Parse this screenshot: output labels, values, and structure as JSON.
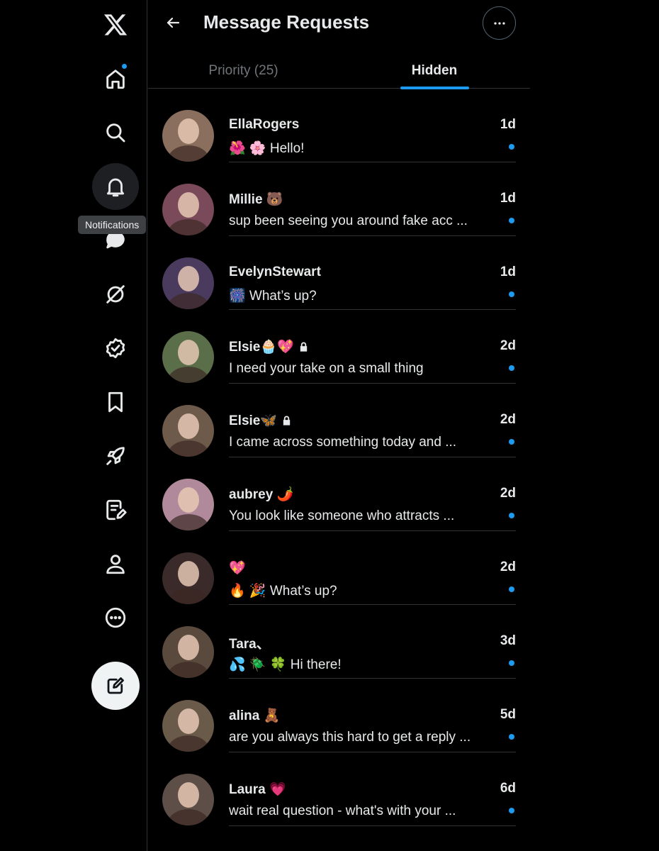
{
  "header": {
    "title": "Message Requests"
  },
  "tabs": [
    {
      "label": "Priority (25)",
      "active": false
    },
    {
      "label": "Hidden",
      "active": true
    }
  ],
  "sidebar": {
    "tooltip": "Notifications",
    "items": [
      {
        "icon": "x-logo-icon"
      },
      {
        "icon": "home-icon",
        "has_dot": true
      },
      {
        "icon": "search-icon"
      },
      {
        "icon": "bell-icon"
      },
      {
        "icon": "chat-bubble-icon"
      },
      {
        "icon": "grok-icon"
      },
      {
        "icon": "verified-badge-icon"
      },
      {
        "icon": "bookmark-icon"
      },
      {
        "icon": "rocket-icon"
      },
      {
        "icon": "notes-icon"
      },
      {
        "icon": "profile-icon"
      },
      {
        "icon": "more-circle-icon"
      },
      {
        "icon": "compose-icon"
      }
    ]
  },
  "messages": [
    {
      "name": "EllaRogers",
      "verified_lock": false,
      "time": "1d",
      "preview": "🌺 🌸 Hello!",
      "avatar_color": "#8b6f5e"
    },
    {
      "name": "Millie 🐻",
      "verified_lock": false,
      "time": "1d",
      "preview": "sup been seeing you around fake acc ...",
      "avatar_color": "#7a4a5a"
    },
    {
      "name": "EvelynStewart",
      "verified_lock": false,
      "time": "1d",
      "preview": "🎆 What’s up?",
      "avatar_color": "#4a3a5e"
    },
    {
      "name": "Elsie🧁💖",
      "verified_lock": true,
      "time": "2d",
      "preview": "I need your take on a small thing",
      "avatar_color": "#5a6e4a"
    },
    {
      "name": "Elsie🦋",
      "verified_lock": true,
      "time": "2d",
      "preview": "I came across something today and ...",
      "avatar_color": "#6e5a4a"
    },
    {
      "name": "aubrey 🌶️",
      "verified_lock": false,
      "time": "2d",
      "preview": "You look like someone who attracts ...",
      "avatar_color": "#b08a9a"
    },
    {
      "name": "💖",
      "verified_lock": false,
      "time": "2d",
      "preview": "🔥 🎉 What’s up?",
      "avatar_color": "#3a2a2a"
    },
    {
      "name": "Tara、",
      "verified_lock": false,
      "time": "3d",
      "preview": "💦 🪲 🍀 Hi there!",
      "avatar_color": "#5a4a3e"
    },
    {
      "name": "alina 🧸",
      "verified_lock": false,
      "time": "5d",
      "preview": "are you always this hard to get a reply ...",
      "avatar_color": "#6a5a4a"
    },
    {
      "name": "Laura 💗",
      "verified_lock": false,
      "time": "6d",
      "preview": "wait real question - what's with your ...",
      "avatar_color": "#5e4e48"
    }
  ]
}
